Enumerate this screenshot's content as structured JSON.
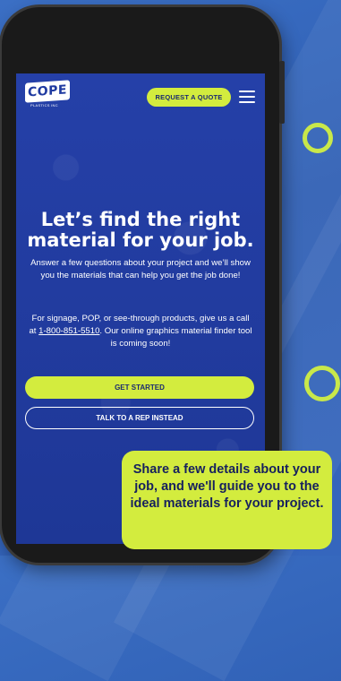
{
  "brand": {
    "logo_text": "COPE",
    "logo_subtext": "PLASTICS INC"
  },
  "header": {
    "quote_button_label": "REQUEST A QUOTE",
    "menu_icon": "hamburger-menu-icon"
  },
  "hero": {
    "headline_line1": "Let’s find the right",
    "headline_line2": "material for your job.",
    "intro_text": "Answer a few questions about your project and we’ll show you the materials that can help you get the job done!",
    "call_text_before": "For signage, POP, or see-through products, give us a call at ",
    "phone_number": "1-800-851-5510",
    "call_text_after": ". Our online graphics material finder tool is coming soon!"
  },
  "actions": {
    "primary_label": "GET STARTED",
    "secondary_label": "TALK TO A REP INSTEAD"
  },
  "callout": {
    "text": "Share a few details about your job, and we'll guide you to the ideal materials for your project."
  },
  "colors": {
    "accent": "#d3ec3e",
    "screen_blue": "#1f3aa0",
    "background_blue": "#3566bd"
  }
}
